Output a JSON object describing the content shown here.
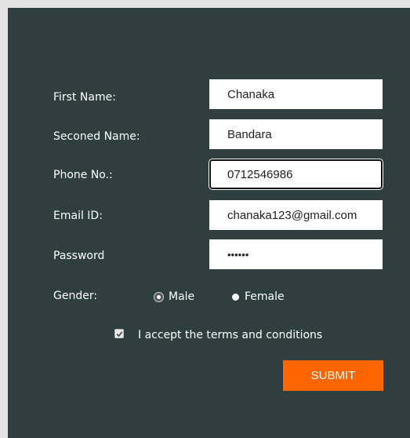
{
  "form": {
    "first_name": {
      "label": "First Name:",
      "value": "Chanaka"
    },
    "second_name": {
      "label": "Seconed Name:",
      "value": "Bandara"
    },
    "phone": {
      "label": "Phone No.:",
      "value": "0712546986"
    },
    "email": {
      "label": "Email ID:",
      "value": "chanaka123@gmail.com"
    },
    "password": {
      "label": "Password",
      "value": "••••••"
    },
    "gender": {
      "label": "Gender:",
      "options": [
        {
          "label": "Male",
          "selected": true
        },
        {
          "label": "Female",
          "selected": false
        }
      ]
    },
    "terms": {
      "label": "I accept the terms and conditions",
      "checked": true
    },
    "submit_label": "SUBMIT"
  },
  "colors": {
    "panel": "#2f3f3f",
    "accent": "#ff6600",
    "page": "#e3e3e3"
  }
}
